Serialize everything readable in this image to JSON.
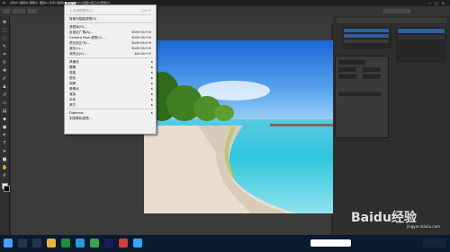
{
  "menubar": {
    "items": [
      "文件(F)",
      "编辑(E)",
      "图像(I)",
      "图层(L)",
      "文字(Y)",
      "选择(S)",
      "滤镜(T)",
      "3D(D)",
      "视图(V)",
      "窗口(W)",
      "帮助(H)"
    ]
  },
  "filter_menu": {
    "items": [
      {
        "label": "上次滤镜操作(F)",
        "shortcut": "Ctrl+F",
        "disabled": true
      },
      {
        "separator": true
      },
      {
        "label": "转换为智能滤镜(S)"
      },
      {
        "separator": true
      },
      {
        "label": "滤镜库(G)..."
      },
      {
        "label": "自适应广角(A)...",
        "shortcut": "Shift+Ctrl+A"
      },
      {
        "label": "Camera Raw 滤镜(C)...",
        "shortcut": "Shift+Ctrl+A"
      },
      {
        "label": "镜头校正(R)...",
        "shortcut": "Shift+Ctrl+R"
      },
      {
        "label": "液化(L)...",
        "shortcut": "Shift+Ctrl+X"
      },
      {
        "label": "消失点(V)...",
        "shortcut": "Alt+Ctrl+V"
      },
      {
        "separator": true
      },
      {
        "label": "风格化",
        "submenu": true
      },
      {
        "label": "模糊",
        "submenu": true
      },
      {
        "label": "扭曲",
        "submenu": true
      },
      {
        "label": "锐化",
        "submenu": true
      },
      {
        "label": "视频",
        "submenu": true
      },
      {
        "label": "像素化",
        "submenu": true
      },
      {
        "label": "渲染",
        "submenu": true
      },
      {
        "label": "杂色",
        "submenu": true
      },
      {
        "label": "其它",
        "submenu": true
      },
      {
        "separator": true
      },
      {
        "label": "Digimarc",
        "submenu": true
      },
      {
        "label": "浏览联机滤镜..."
      }
    ]
  },
  "icons": {
    "search": "search-icon",
    "windows": "windows-logo-icon"
  },
  "colors": {
    "menu_bg": "#f0f0f0",
    "ui_dark": "#282828",
    "taskbar": "#0b1a2f"
  },
  "watermark": {
    "text": "Baidu经验",
    "sub": "jingyan.baidu.com"
  }
}
